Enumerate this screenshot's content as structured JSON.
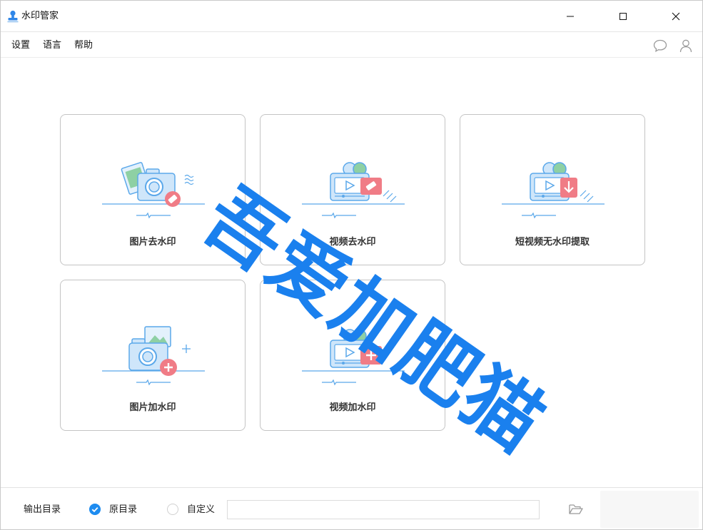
{
  "window": {
    "title": "水印管家"
  },
  "menu": {
    "items": [
      "设置",
      "语言",
      "帮助"
    ]
  },
  "icons": {
    "app": "stamp-icon",
    "feedback": "chat-bubble-icon",
    "account": "user-icon",
    "folder": "folder-open-icon"
  },
  "cards": [
    {
      "label": "图片去水印",
      "icon": "camera-eraser-icon"
    },
    {
      "label": "视频去水印",
      "icon": "video-eraser-icon"
    },
    {
      "label": "短视频无水印提取",
      "icon": "video-download-icon"
    },
    {
      "label": "图片加水印",
      "icon": "camera-plus-icon"
    },
    {
      "label": "视频加水印",
      "icon": "video-plus-icon"
    }
  ],
  "overlay_watermark": "吾爱加肥猫",
  "footer": {
    "output_label": "输出目录",
    "options": [
      {
        "label": "原目录",
        "selected": true
      },
      {
        "label": "自定义",
        "selected": false
      }
    ],
    "path_value": ""
  },
  "colors": {
    "accent": "#1e8cf0",
    "watermark": "#1a80ee",
    "badge": "#f07c86",
    "illustration": "#5ba8ea"
  }
}
